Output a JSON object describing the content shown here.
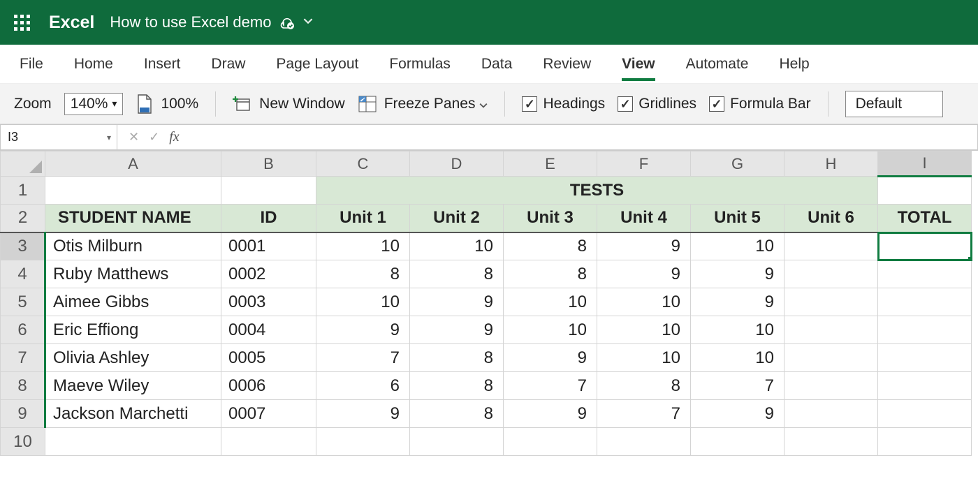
{
  "title_bar": {
    "app_name": "Excel",
    "doc_name": "How to use Excel demo"
  },
  "tabs": {
    "file": "File",
    "home": "Home",
    "insert": "Insert",
    "draw": "Draw",
    "page_layout": "Page Layout",
    "formulas": "Formulas",
    "data": "Data",
    "review": "Review",
    "view": "View",
    "automate": "Automate",
    "help": "Help",
    "active": "view"
  },
  "ribbon": {
    "zoom_label": "Zoom",
    "zoom_value": "140%",
    "zoom_100": "100%",
    "new_window": "New Window",
    "freeze": "Freeze Panes",
    "headings": "Headings",
    "gridlines": "Gridlines",
    "formula_bar": "Formula Bar",
    "view_mode": "Default"
  },
  "fx": {
    "name_box": "I3",
    "cancel_glyph": "✕",
    "accept_glyph": "✓",
    "fx_label": "fx",
    "value": ""
  },
  "sheet": {
    "columns": [
      "A",
      "B",
      "C",
      "D",
      "E",
      "F",
      "G",
      "H",
      "I"
    ],
    "row_numbers": [
      "1",
      "2",
      "3",
      "4",
      "5",
      "6",
      "7",
      "8",
      "9",
      "10"
    ],
    "tests_merged_label": "TESTS",
    "headers": {
      "student": "STUDENT NAME",
      "id": "ID",
      "u1": "Unit 1",
      "u2": "Unit 2",
      "u3": "Unit 3",
      "u4": "Unit 4",
      "u5": "Unit 5",
      "u6": "Unit 6",
      "total": "TOTAL"
    },
    "rows": [
      {
        "name": "Otis Milburn",
        "id": "0001",
        "u1": "10",
        "u2": "10",
        "u3": "8",
        "u4": "9",
        "u5": "10",
        "u6": "",
        "total": ""
      },
      {
        "name": "Ruby Matthews",
        "id": "0002",
        "u1": "8",
        "u2": "8",
        "u3": "8",
        "u4": "9",
        "u5": "9",
        "u6": "",
        "total": ""
      },
      {
        "name": "Aimee Gibbs",
        "id": "0003",
        "u1": "10",
        "u2": "9",
        "u3": "10",
        "u4": "10",
        "u5": "9",
        "u6": "",
        "total": ""
      },
      {
        "name": "Eric Effiong",
        "id": "0004",
        "u1": "9",
        "u2": "9",
        "u3": "10",
        "u4": "10",
        "u5": "10",
        "u6": "",
        "total": ""
      },
      {
        "name": "Olivia Ashley",
        "id": "0005",
        "u1": "7",
        "u2": "8",
        "u3": "9",
        "u4": "10",
        "u5": "10",
        "u6": "",
        "total": ""
      },
      {
        "name": "Maeve Wiley",
        "id": "0006",
        "u1": "6",
        "u2": "8",
        "u3": "7",
        "u4": "8",
        "u5": "7",
        "u6": "",
        "total": ""
      },
      {
        "name": "Jackson Marchetti",
        "id": "0007",
        "u1": "9",
        "u2": "8",
        "u3": "9",
        "u4": "7",
        "u5": "9",
        "u6": "",
        "total": ""
      }
    ],
    "selected_cell": "I3"
  }
}
